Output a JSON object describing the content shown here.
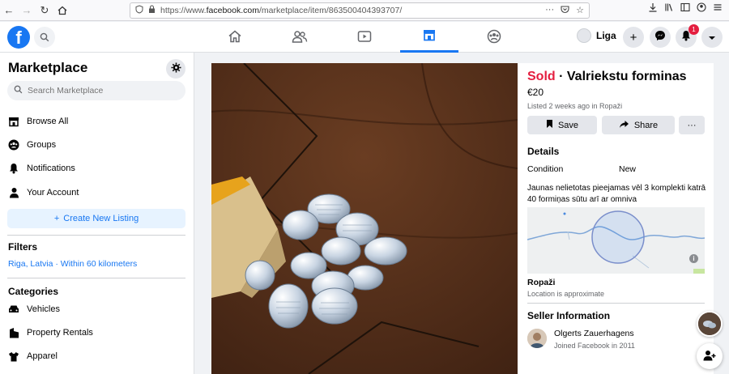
{
  "browser": {
    "url_prefix": "https://www.",
    "url_domain": "facebook.com",
    "url_path": "/marketplace/item/863500404393707/"
  },
  "topnav": {
    "user_name": "Liga",
    "notification_count": "1"
  },
  "sidebar": {
    "title": "Marketplace",
    "search_placeholder": "Search Marketplace",
    "items": [
      {
        "label": "Browse All",
        "icon": "storefront-icon"
      },
      {
        "label": "Groups",
        "icon": "groups-icon"
      },
      {
        "label": "Notifications",
        "icon": "bell-icon"
      },
      {
        "label": "Your Account",
        "icon": "person-icon"
      }
    ],
    "create_label": "Create New Listing",
    "filters_heading": "Filters",
    "location_filter": "Riga, Latvia · Within 60 kilometers",
    "categories_heading": "Categories",
    "categories": [
      {
        "label": "Vehicles",
        "icon": "car-icon"
      },
      {
        "label": "Property Rentals",
        "icon": "building-icon"
      },
      {
        "label": "Apparel",
        "icon": "shirt-icon"
      }
    ]
  },
  "listing": {
    "status": "Sold",
    "separator": " · ",
    "title": "Valriekstu forminas",
    "price": "€20",
    "listed": "Listed 2 weeks ago in Ropaži",
    "save_label": "Save",
    "share_label": "Share",
    "more_label": "···",
    "details_heading": "Details",
    "condition_label": "Condition",
    "condition_value": "New",
    "description": "Jaunas nelietotas  pieejamas vēl 3 komplekti katrā 40 formiņas sūtu arī ar omniva",
    "location_name": "Ropaži",
    "location_note": "Location is approximate",
    "seller_heading": "Seller Information",
    "seller_name": "Olgerts Zauerhagens",
    "seller_joined": "Joined Facebook in 2011"
  },
  "colors": {
    "brand": "#1877f2",
    "sold": "#e41e3f",
    "background": "#f0f2f5"
  }
}
